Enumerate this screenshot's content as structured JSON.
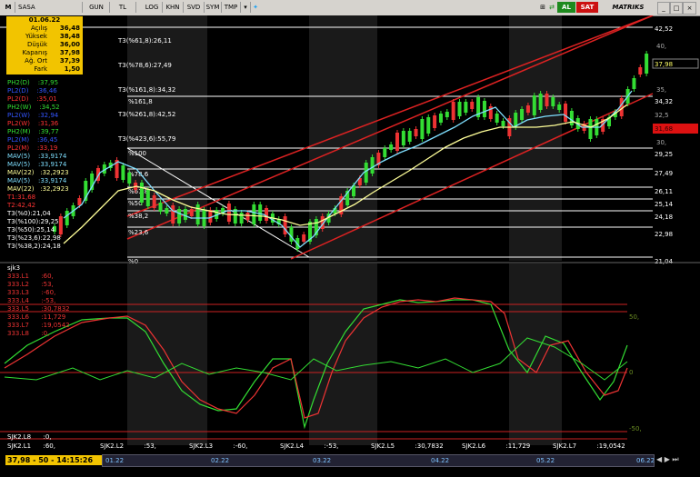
{
  "toolbar": {
    "app_logo": "M",
    "symbol": "SASA",
    "buttons": [
      "GUN",
      "TL",
      "LOG",
      "KHN",
      "SVD",
      "SYM",
      "TMP"
    ],
    "al_label": "AL",
    "sat_label": "SAT",
    "brand": "MATRIKS",
    "colors": {
      "al": "#1e8a1e",
      "sat": "#cc1111"
    }
  },
  "info_box": {
    "date": "01.06.22",
    "rows": [
      {
        "label": "Açılış",
        "value": "36,48"
      },
      {
        "label": "Yüksek",
        "value": "38,48"
      },
      {
        "label": "Düşük",
        "value": "36,00"
      },
      {
        "label": "Kapanış",
        "value": "37,98"
      },
      {
        "label": "Ağ. Ort",
        "value": "37,39"
      },
      {
        "label": "Fark",
        "value": "1,50"
      }
    ]
  },
  "fib_legend": [
    "T3(%61,8):26,11",
    "T3(%78,6):27,49",
    "T3(%161,8):34,32",
    "T3(%261,8):42,52",
    "T3(%423,6):55,79"
  ],
  "indicator_legend": [
    {
      "text": "PH2(D)    :37,95",
      "color": "#33dd33"
    },
    {
      "text": "PL2(D)    :36,46",
      "color": "#3355ff"
    },
    {
      "text": "PL2(D)    :35,01",
      "color": "#ff3333"
    },
    {
      "text": "PH2(W)    :34,52",
      "color": "#33dd33"
    },
    {
      "text": "PL2(W)    :32,94",
      "color": "#3355ff"
    },
    {
      "text": "PL2(W)    :31,36",
      "color": "#ff3333"
    },
    {
      "text": "PH2(M)    :39,77",
      "color": "#33dd33"
    },
    {
      "text": "PL2(M)    :36,45",
      "color": "#3355ff"
    },
    {
      "text": "PL2(M)    :33,19",
      "color": "#ff3333"
    },
    {
      "text": "MAV(5)    :33,9174",
      "color": "#7fdfff"
    },
    {
      "text": "MAV(5)    :33,9174",
      "color": "#7fdfff"
    },
    {
      "text": "MAV(22)   :32,2923",
      "color": "#ffff99"
    },
    {
      "text": "MAV(5)    :33,9174",
      "color": "#7fdfff"
    },
    {
      "text": "MAV(22)   :32,2923",
      "color": "#ffff99"
    },
    {
      "text": "T1:31,68",
      "color": "#ff3333"
    },
    {
      "text": "T2:42,42",
      "color": "#ff3333"
    },
    {
      "text": "T3(%0):21,04",
      "color": "#ffffff"
    },
    {
      "text": "T3(%100):29,25",
      "color": "#ffffff"
    },
    {
      "text": "T3(%50):25,14",
      "color": "#ffffff"
    },
    {
      "text": "T3(%23,6):22,98",
      "color": "#ffffff"
    },
    {
      "text": "T3(%38,2):24,18",
      "color": "#ffffff"
    }
  ],
  "fib_labels": [
    "%161,8",
    "%100",
    "%78,6",
    "%61,8",
    "%50",
    "%38,2",
    "%23,6",
    "%0"
  ],
  "price_axis": [
    {
      "label": "42,52",
      "type": "fib"
    },
    {
      "label": "40,",
      "type": "grid"
    },
    {
      "label": "37,98",
      "type": "price"
    },
    {
      "label": "35,",
      "type": "grid"
    },
    {
      "label": "34,32",
      "type": "fib"
    },
    {
      "label": "32,5",
      "type": "grid"
    },
    {
      "label": "31,68",
      "type": "red"
    },
    {
      "label": "30,",
      "type": "grid"
    },
    {
      "label": "29,25",
      "type": "fib"
    },
    {
      "label": "27,49",
      "type": "fib"
    },
    {
      "label": "26,11",
      "type": "fib"
    },
    {
      "label": "25,14",
      "type": "fib"
    },
    {
      "label": "24,18",
      "type": "fib"
    },
    {
      "label": "22,98",
      "type": "fib"
    },
    {
      "label": "21,04",
      "type": "fib"
    }
  ],
  "oscillator": {
    "title": "sjk3",
    "legend": [
      "333.L1      :60,",
      "333.L2      :53,",
      "333.L3      :-60,",
      "333.L4      :-53,",
      "333.L5      :30,7832",
      "333.L6      :11,729",
      "333.L7      :19,0542",
      "333.L8      :0,"
    ],
    "axis": [
      "50,",
      "0",
      "-50,"
    ],
    "bottom_legend": [
      "SJK2.L8      :0,",
      "SJK2.L1      :60,"
    ],
    "bottom_markers": [
      "SJK2.L2          :53,",
      "SJK2.L3          :-60,",
      "SJK2.L4          :-53,",
      "SJK2.L5          :30,7832",
      "SJK2.L6          :11,729",
      "SJK2.L7          :19,0542"
    ]
  },
  "status": {
    "price_time": "37,98 - 50 - 14:15:26",
    "dates": [
      "01.22",
      "02.22",
      "03.22",
      "04.22",
      "05.22",
      "06.22"
    ]
  }
}
